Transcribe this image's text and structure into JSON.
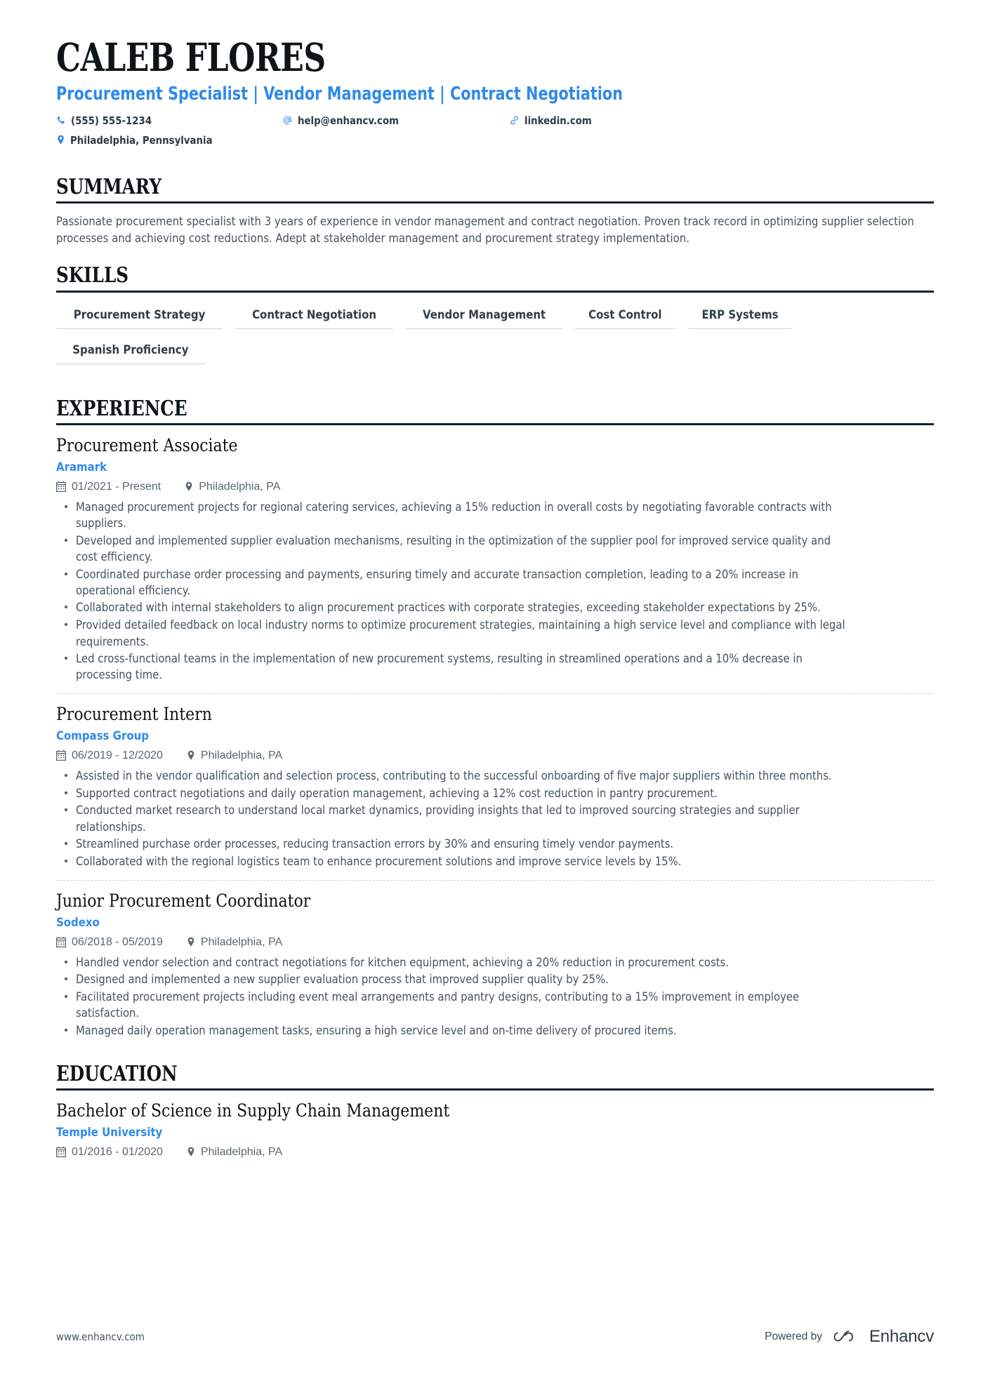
{
  "header": {
    "name": "CALEB FLORES",
    "headline": "Procurement Specialist | Vendor Management | Contract Negotiation",
    "contacts": {
      "phone": "(555) 555-1234",
      "email": "help@enhancv.com",
      "linkedin": "linkedin.com",
      "location": "Philadelphia, Pennsylvania"
    }
  },
  "summary": {
    "title": "SUMMARY",
    "text": "Passionate procurement specialist with 3 years of experience in vendor management and contract negotiation. Proven track record in optimizing supplier selection processes and achieving cost reductions. Adept at stakeholder management and procurement strategy implementation."
  },
  "skills": {
    "title": "SKILLS",
    "items": [
      "Procurement Strategy",
      "Contract Negotiation",
      "Vendor Management",
      "Cost Control",
      "ERP Systems",
      "Spanish Proficiency"
    ]
  },
  "experience": {
    "title": "EXPERIENCE",
    "entries": [
      {
        "job_title": "Procurement Associate",
        "company": "Aramark",
        "dates": "01/2021 - Present",
        "location": "Philadelphia, PA",
        "bullets": [
          "Managed procurement projects for regional catering services, achieving a 15% reduction in overall costs by negotiating favorable contracts with suppliers.",
          "Developed and implemented supplier evaluation mechanisms, resulting in the optimization of the supplier pool for improved service quality and cost efficiency.",
          "Coordinated purchase order processing and payments, ensuring timely and accurate transaction completion, leading to a 20% increase in operational efficiency.",
          "Collaborated with internal stakeholders to align procurement practices with corporate strategies, exceeding stakeholder expectations by 25%.",
          "Provided detailed feedback on local industry norms to optimize procurement strategies, maintaining a high service level and compliance with legal requirements.",
          "Led cross-functional teams in the implementation of new procurement systems, resulting in streamlined operations and a 10% decrease in processing time."
        ]
      },
      {
        "job_title": "Procurement Intern",
        "company": "Compass Group",
        "dates": "06/2019 - 12/2020",
        "location": "Philadelphia, PA",
        "bullets": [
          "Assisted in the vendor qualification and selection process, contributing to the successful onboarding of five major suppliers within three months.",
          "Supported contract negotiations and daily operation management, achieving a 12% cost reduction in pantry procurement.",
          "Conducted market research to understand local market dynamics, providing insights that led to improved sourcing strategies and supplier relationships.",
          "Streamlined purchase order processes, reducing transaction errors by 30% and ensuring timely vendor payments.",
          "Collaborated with the regional logistics team to enhance procurement solutions and improve service levels by 15%."
        ]
      },
      {
        "job_title": "Junior Procurement Coordinator",
        "company": "Sodexo",
        "dates": "06/2018 - 05/2019",
        "location": "Philadelphia, PA",
        "bullets": [
          "Handled vendor selection and contract negotiations for kitchen equipment, achieving a 20% reduction in procurement costs.",
          "Designed and implemented a new supplier evaluation process that improved supplier quality by 25%.",
          "Facilitated procurement projects including event meal arrangements and pantry designs, contributing to a 15% improvement in employee satisfaction.",
          "Managed daily operation management tasks, ensuring a high service level and on-time delivery of procured items."
        ]
      }
    ]
  },
  "education": {
    "title": "EDUCATION",
    "entries": [
      {
        "degree": "Bachelor of Science in Supply Chain Management",
        "school": "Temple University",
        "dates": "01/2016 - 01/2020",
        "location": "Philadelphia, PA"
      }
    ]
  },
  "footer": {
    "url": "www.enhancv.com",
    "powered_by": "Powered by",
    "brand": "Enhancv"
  },
  "colors": {
    "accent": "#2f8ae8",
    "heading": "#0f1417",
    "body": "#45535c",
    "meta": "#59666f",
    "rule": "#16212a",
    "skill_underline": "#cfd6da"
  }
}
